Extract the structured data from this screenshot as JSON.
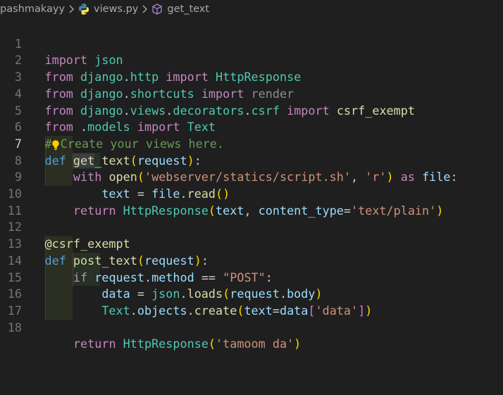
{
  "breadcrumb": {
    "folder": "pashmakayy",
    "file": "views.py",
    "symbol": "get_text"
  },
  "editor": {
    "language": "python",
    "active_line": 7,
    "lines": [
      {
        "n": "1",
        "text": "import json"
      },
      {
        "n": "2",
        "text": "from django.http import HttpResponse"
      },
      {
        "n": "3",
        "text": "from django.shortcuts import render"
      },
      {
        "n": "4",
        "text": "from django.views.decorators.csrf import csrf_exempt"
      },
      {
        "n": "5",
        "text": "from .models import Text"
      },
      {
        "n": "6",
        "text": "# Create your views here."
      },
      {
        "n": "7",
        "text": "def get_text(request):"
      },
      {
        "n": "8",
        "text": "    with open('webserver/statics/script.sh', 'r') as file:"
      },
      {
        "n": "9",
        "text": "        text = file.read()"
      },
      {
        "n": "10",
        "text": "    return HttpResponse(text, content_type='text/plain')"
      },
      {
        "n": "11",
        "text": ""
      },
      {
        "n": "12",
        "text": "@csrf_exempt"
      },
      {
        "n": "13",
        "text": "def post_text(request):"
      },
      {
        "n": "14",
        "text": "    if request.method == \"POST\":"
      },
      {
        "n": "15",
        "text": "        data = json.loads(request.body)"
      },
      {
        "n": "16",
        "text": "        Text.objects.create(text=data['data'])"
      },
      {
        "n": "17",
        "text": ""
      },
      {
        "n": "18",
        "text": "    return HttpResponse('tamoom da')"
      }
    ]
  },
  "colors": {
    "background": "#1f1f1f",
    "keyword": "#569cd6",
    "control_keyword": "#c586c0",
    "function": "#dcdcaa",
    "string": "#ce9178",
    "comment": "#6a9955",
    "class": "#4ec9b0",
    "variable": "#9cdcfe",
    "bracket_level1": "#ffd700",
    "bracket_level2": "#da70d6"
  },
  "icons": {
    "breadcrumb_separator": "chevron-right-icon",
    "file_icon": "python-icon",
    "symbol_icon": "method-cube-icon",
    "lightbulb": "lightbulb-icon"
  }
}
